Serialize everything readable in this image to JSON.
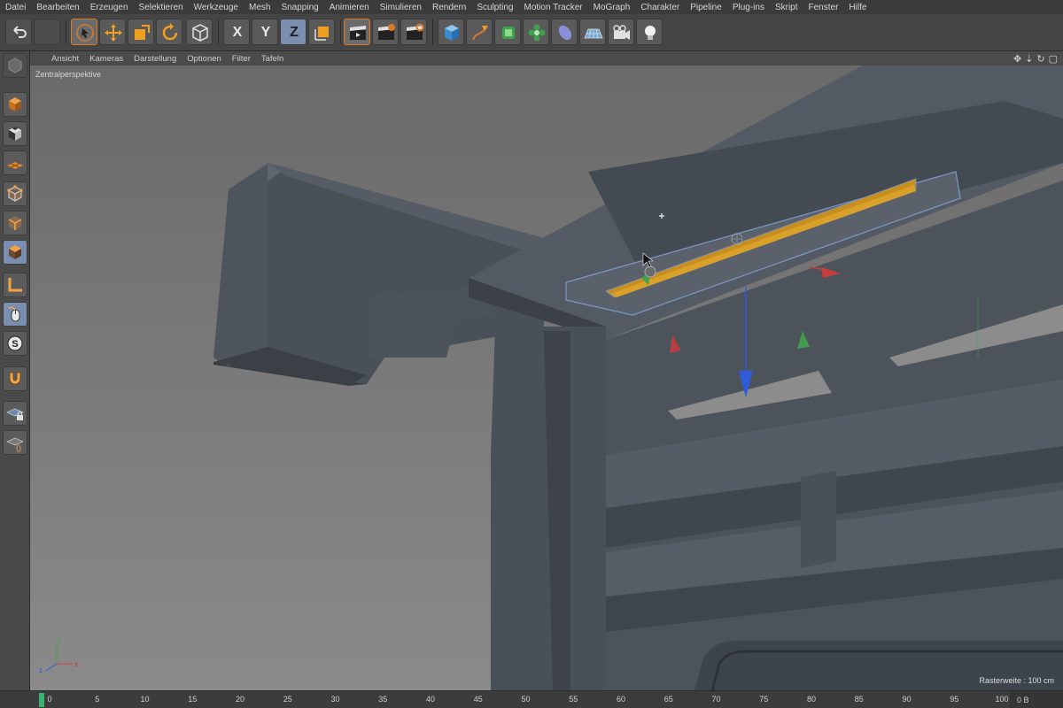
{
  "menu": [
    "Datei",
    "Bearbeiten",
    "Erzeugen",
    "Selektieren",
    "Werkzeuge",
    "Mesh",
    "Snapping",
    "Animieren",
    "Simulieren",
    "Rendern",
    "Sculpting",
    "Motion Tracker",
    "MoGraph",
    "Charakter",
    "Pipeline",
    "Plug-ins",
    "Skript",
    "Fenster",
    "Hilfe"
  ],
  "toolbar": {
    "axis_x": "X",
    "axis_y": "Y",
    "axis_z": "Z"
  },
  "viewport_menu": [
    "Ansicht",
    "Kameras",
    "Darstellung",
    "Optionen",
    "Filter",
    "Tafeln"
  ],
  "viewport": {
    "perspective_label": "Zentralperspektive",
    "raster_label": "Rasterweite : 100 cm",
    "nav_icons": [
      "move-view-icon",
      "zoom-view-icon",
      "rotate-view-icon",
      "maximize-view-icon"
    ]
  },
  "timeline": {
    "ticks": [
      "0",
      "5",
      "10",
      "15",
      "20",
      "25",
      "30",
      "35",
      "40",
      "45",
      "50",
      "55",
      "60",
      "65",
      "70",
      "75",
      "80",
      "85",
      "90",
      "95",
      "100"
    ],
    "end_field": "0 B"
  },
  "colors": {
    "accent_orange": "#d87a2a",
    "selection_yellow": "#d4a017",
    "axis_x": "#d23b3b",
    "axis_y": "#3fa34d",
    "axis_z": "#2f5bd8"
  }
}
